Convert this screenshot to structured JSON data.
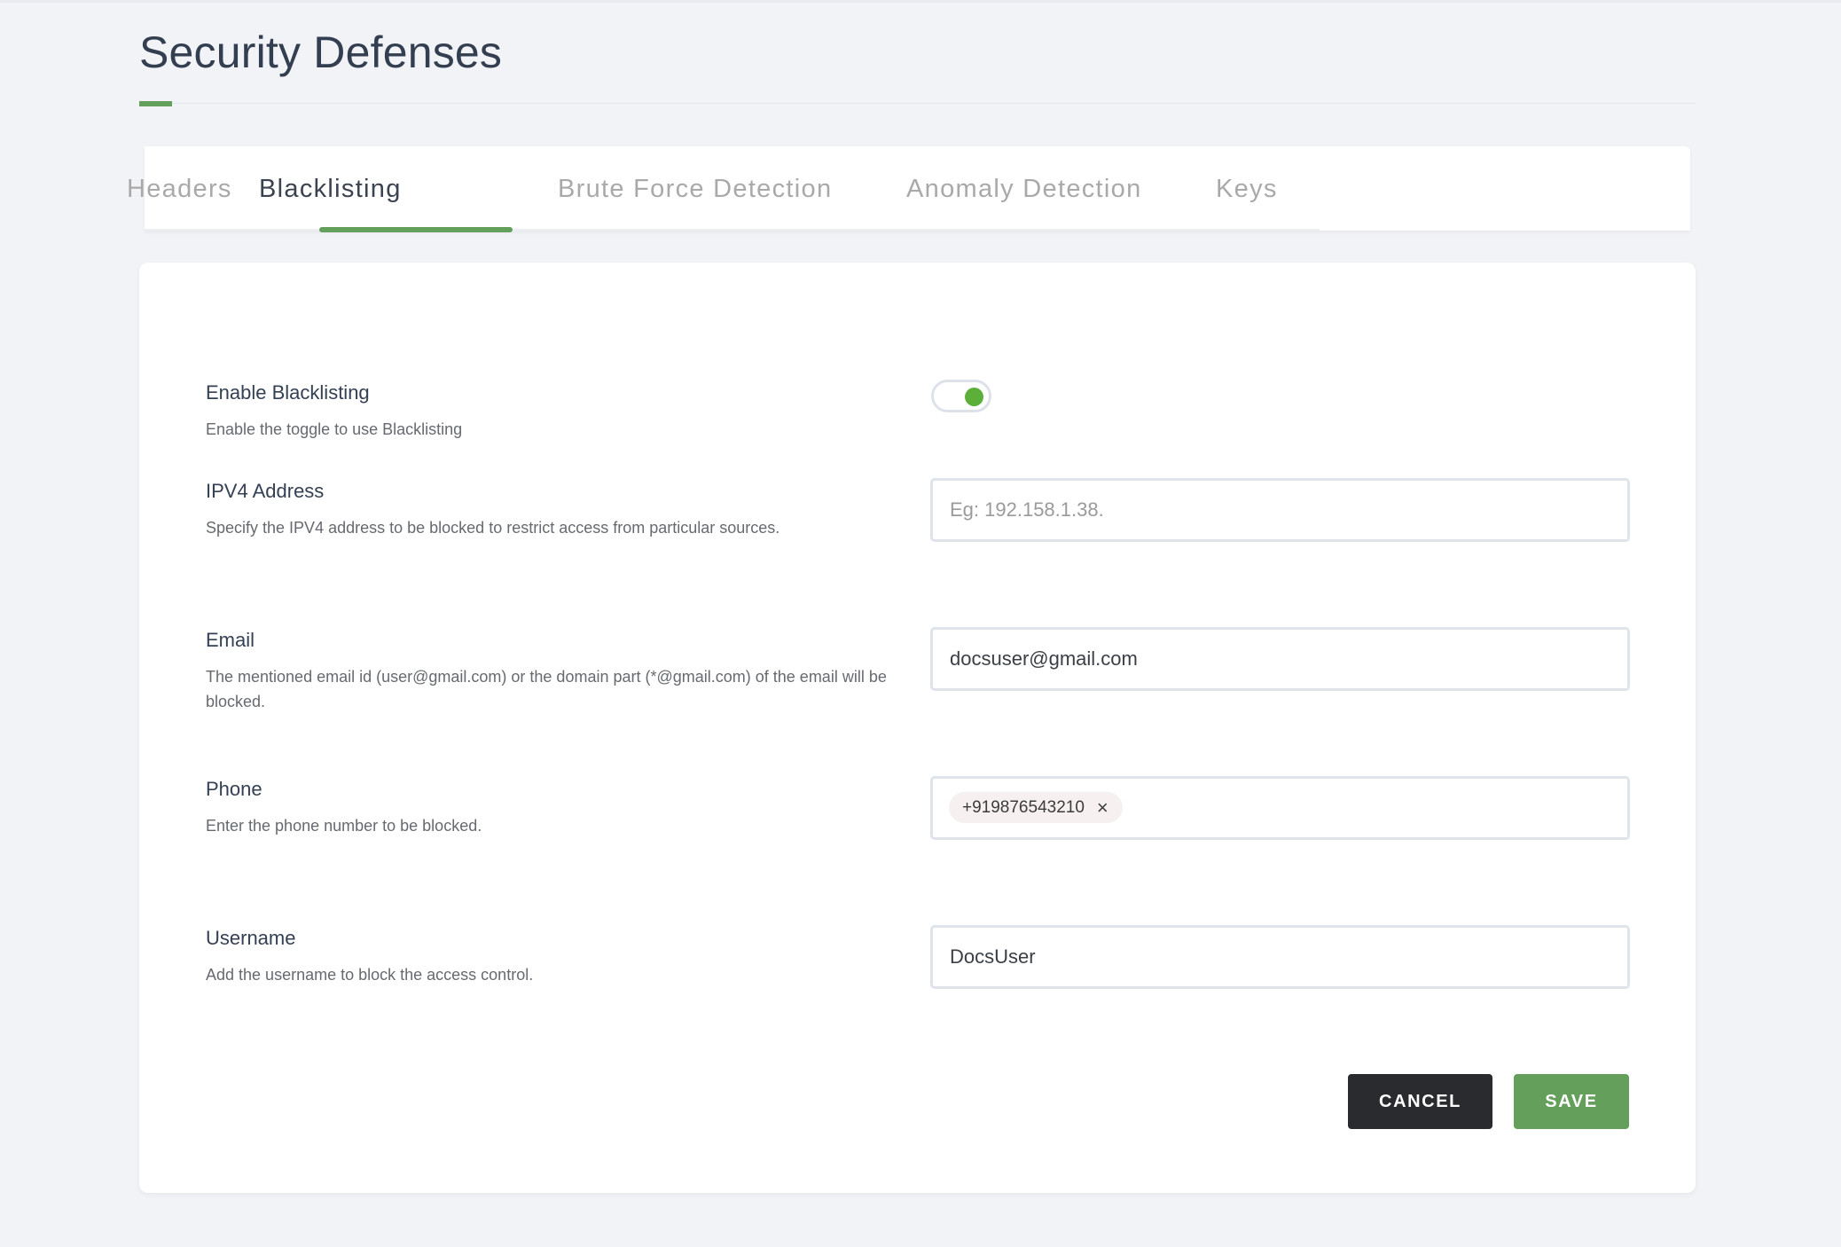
{
  "page": {
    "title": "Security Defenses",
    "accent_color": "#64a05c"
  },
  "tabs": [
    {
      "label": "Headers",
      "active": false
    },
    {
      "label": "Blacklisting",
      "active": true
    },
    {
      "label": "Brute Force Detection",
      "active": false
    },
    {
      "label": "Anomaly Detection",
      "active": false
    },
    {
      "label": "Keys",
      "active": false
    }
  ],
  "form": {
    "enable_blacklisting": {
      "label": "Enable Blacklisting",
      "description": "Enable the toggle to use Blacklisting",
      "enabled": true
    },
    "ipv4": {
      "label": "IPV4 Address",
      "description": "Specify the IPV4 address to be blocked to restrict access from particular sources.",
      "value": "",
      "placeholder": "Eg: 192.158.1.38."
    },
    "email": {
      "label": "Email",
      "description": "The mentioned email id (user@gmail.com) or the domain part (*@gmail.com) of the email will be blocked.",
      "value": "docsuser@gmail.com"
    },
    "phone": {
      "label": "Phone",
      "description": "Enter the phone number to be blocked.",
      "chips": [
        "+919876543210"
      ],
      "chip_remove_icon": "×"
    },
    "username": {
      "label": "Username",
      "description": "Add the username to block the access control.",
      "value": "DocsUser"
    }
  },
  "actions": {
    "cancel_label": "CANCEL",
    "save_label": "SAVE"
  }
}
